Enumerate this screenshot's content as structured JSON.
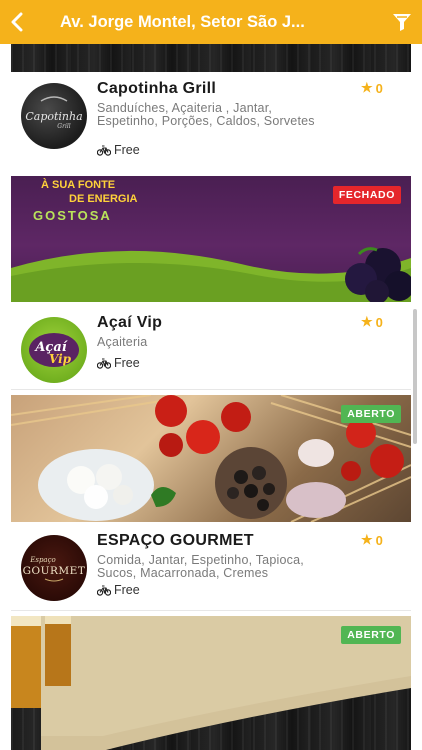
{
  "header": {
    "title": "Av. Jorge Montel, Setor São J...",
    "back_icon": "chevron-left-icon",
    "filter_icon": "funnel-filter-icon",
    "bg_color": "#f5b21b"
  },
  "restaurants": [
    {
      "name": "Capotinha Grill",
      "categories": "Sanduíches, Açaiteria , Jantar, Espetinho, Porções, Caldos, Sorvetes",
      "delivery": "Free",
      "rating": "0",
      "logo_text": "Capotinha",
      "logo_sub": "Grill"
    },
    {
      "name": "Açaí Vip",
      "categories": "Açaiteria",
      "delivery": "Free",
      "rating": "0",
      "banner_status": "FECHADO",
      "logo_text": "Açaí",
      "logo_sub": "Vip",
      "banner_lines": [
        "À SUA FONTE",
        "DE ENERGIA",
        "GOSTOSA"
      ]
    },
    {
      "name": "ESPAÇO GOURMET",
      "categories": "Comida, Jantar, Espetinho, Tapioca, Sucos, Macarronada, Cremes",
      "delivery": "Free",
      "rating": "0",
      "banner_status": "ABERTO",
      "logo_text": "GOURMET",
      "logo_sub": "Espaço"
    }
  ],
  "next_banner_status": "ABERTO",
  "colors": {
    "closed": "#e5262b",
    "open": "#51b653",
    "star": "#f5b21b"
  }
}
